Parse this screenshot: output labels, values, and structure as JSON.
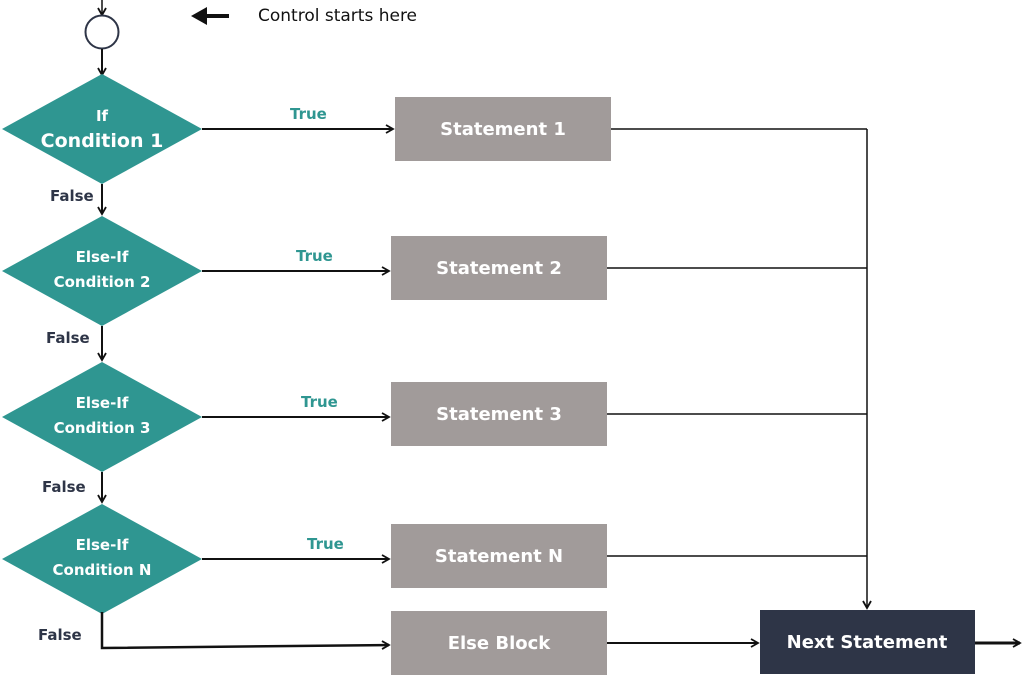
{
  "annotation": {
    "text": "Control starts here",
    "icon": "left-arrow-icon"
  },
  "colors": {
    "condition": "#2f9691",
    "statement": "#a19b9a",
    "next": "#2e3547",
    "true_label": "#2f9691",
    "false_label": "#2e3547",
    "line": "#111111"
  },
  "conditions": [
    {
      "line1": "If",
      "line2": "Condition 1",
      "true_label": "True",
      "false_label": "False"
    },
    {
      "line1": "Else-If",
      "line2": "Condition 2",
      "true_label": "True",
      "false_label": "False"
    },
    {
      "line1": "Else-If",
      "line2": "Condition 3",
      "true_label": "True",
      "false_label": "False"
    },
    {
      "line1": "Else-If",
      "line2": "Condition N",
      "true_label": "True",
      "false_label": "False"
    }
  ],
  "statements": [
    {
      "label": "Statement 1"
    },
    {
      "label": "Statement 2"
    },
    {
      "label": "Statement 3"
    },
    {
      "label": "Statement N"
    }
  ],
  "else_block": {
    "label": "Else Block"
  },
  "next_statement": {
    "label": "Next Statement"
  }
}
